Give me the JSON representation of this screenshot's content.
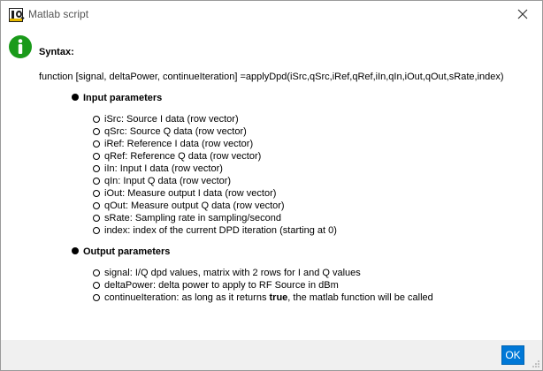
{
  "window": {
    "title": "Matlab script"
  },
  "content": {
    "syntax_label": "Syntax:",
    "signature": "function [signal, deltaPower, continueIteration] =applyDpd(iSrc,qSrc,iRef,qRef,iIn,qIn,iOut,qOut,sRate,index)",
    "input_section": {
      "title": "Input parameters",
      "items": [
        "iSrc: Source I data (row vector)",
        "qSrc: Source Q data (row vector)",
        "iRef: Reference I data (row vector)",
        "qRef: Reference Q data (row vector)",
        "iIn: Input I data (row vector)",
        "qIn: Input Q data (row vector)",
        "iOut: Measure output I data (row vector)",
        "qOut: Measure output Q data (row vector)",
        "sRate: Sampling rate in sampling/second",
        "index: index of the current DPD iteration (starting at 0)"
      ]
    },
    "output_section": {
      "title": "Output parameters",
      "items": [
        "signal: I/Q dpd values, matrix with 2 rows for I and Q values",
        "deltaPower: delta power to apply to RF Source in dBm"
      ],
      "continue_item": {
        "before": "continueIteration: as long as it returns ",
        "bold": "true",
        "after": ", the matlab function will be called"
      }
    }
  },
  "footer": {
    "ok_label": "OK"
  },
  "colors": {
    "accent": "#0078d7",
    "info_icon": "#1a9a1a"
  },
  "icons": {
    "app": "iq-logo-icon",
    "info": "info-icon",
    "close": "close-icon"
  }
}
